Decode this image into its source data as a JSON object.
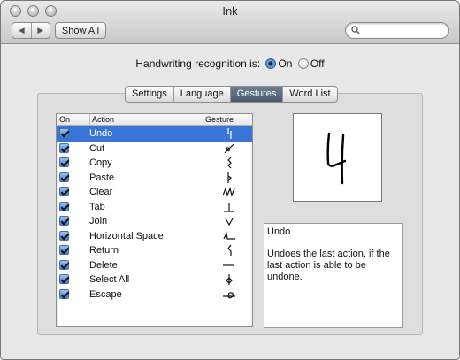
{
  "window": {
    "title": "Ink"
  },
  "toolbar": {
    "back_label": "◀",
    "forward_label": "▶",
    "show_all_label": "Show All",
    "search_placeholder": ""
  },
  "recognition": {
    "label": "Handwriting recognition is:",
    "on_label": "On",
    "off_label": "Off",
    "selected": "On"
  },
  "tabs": [
    {
      "label": "Settings",
      "active": false
    },
    {
      "label": "Language",
      "active": false
    },
    {
      "label": "Gestures",
      "active": true
    },
    {
      "label": "Word List",
      "active": false
    }
  ],
  "table": {
    "headers": {
      "on": "On",
      "action": "Action",
      "gesture": "Gesture"
    },
    "rows": [
      {
        "action": "Undo",
        "enabled": true,
        "selected": true,
        "gesture_icon": "undo-gesture-icon"
      },
      {
        "action": "Cut",
        "enabled": true,
        "selected": false,
        "gesture_icon": "cut-gesture-icon"
      },
      {
        "action": "Copy",
        "enabled": true,
        "selected": false,
        "gesture_icon": "copy-gesture-icon"
      },
      {
        "action": "Paste",
        "enabled": true,
        "selected": false,
        "gesture_icon": "paste-gesture-icon"
      },
      {
        "action": "Clear",
        "enabled": true,
        "selected": false,
        "gesture_icon": "clear-gesture-icon"
      },
      {
        "action": "Tab",
        "enabled": true,
        "selected": false,
        "gesture_icon": "tab-gesture-icon"
      },
      {
        "action": "Join",
        "enabled": true,
        "selected": false,
        "gesture_icon": "join-gesture-icon"
      },
      {
        "action": "Horizontal Space",
        "enabled": true,
        "selected": false,
        "gesture_icon": "horizontal-space-gesture-icon"
      },
      {
        "action": "Return",
        "enabled": true,
        "selected": false,
        "gesture_icon": "return-gesture-icon"
      },
      {
        "action": "Delete",
        "enabled": true,
        "selected": false,
        "gesture_icon": "delete-gesture-icon"
      },
      {
        "action": "Select All",
        "enabled": true,
        "selected": false,
        "gesture_icon": "select-all-gesture-icon"
      },
      {
        "action": "Escape",
        "enabled": true,
        "selected": false,
        "gesture_icon": "escape-gesture-icon"
      }
    ]
  },
  "description": {
    "title": "Undo",
    "body": "Undoes the last action, if the last action is able to be undone."
  },
  "colors": {
    "selection": "#3875d7",
    "active_tab": "#5a6a80"
  }
}
